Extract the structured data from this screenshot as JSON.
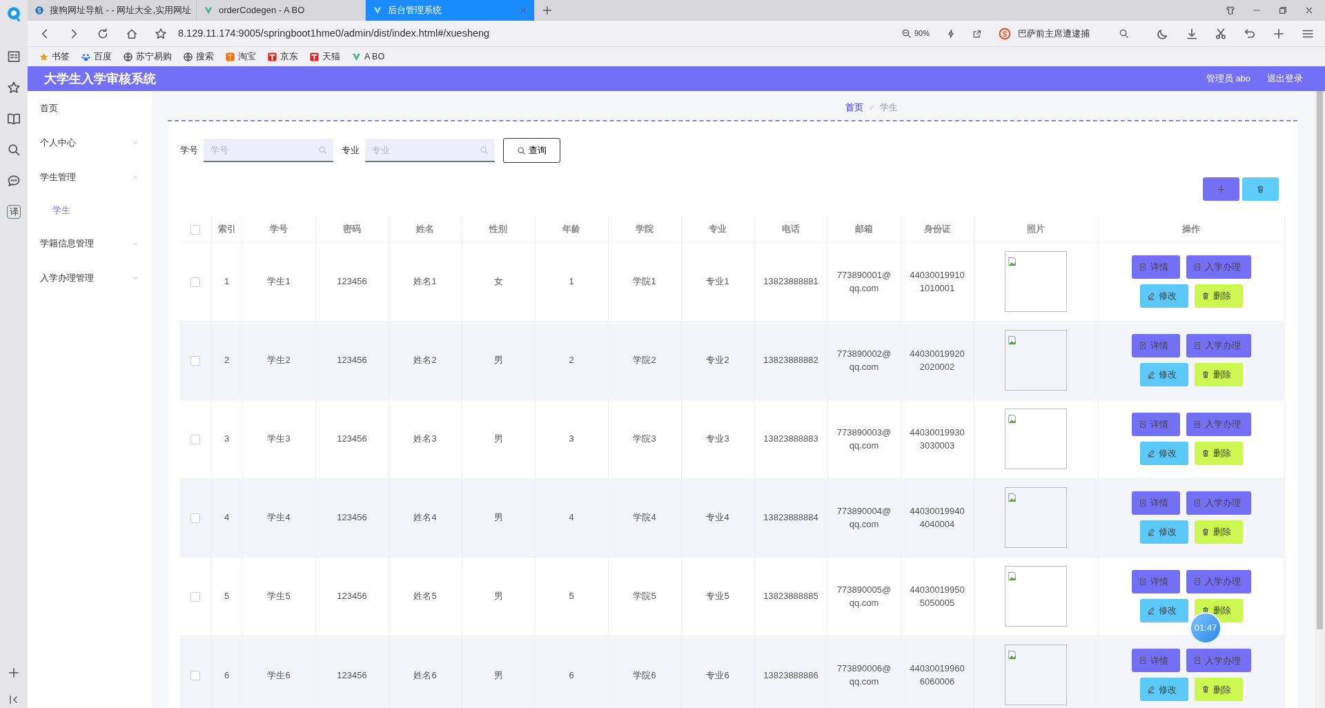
{
  "browser": {
    "tabs": [
      {
        "title": "搜狗网址导航 - - 网址大全,实用网址",
        "selected": false
      },
      {
        "title": "orderCodegen - A BO",
        "selected": false
      },
      {
        "title": "后台管理系统",
        "selected": true
      }
    ],
    "address": "8.129.11.174:9005/springboot1hme0/admin/dist/index.html#/xuesheng",
    "zoom": "90%",
    "search_text": "巴萨前主席遭逮捕",
    "bookmarks": [
      "书签",
      "百度",
      "苏宁易购",
      "搜索",
      "淘宝",
      "京东",
      "天猫",
      "A BO"
    ],
    "side_translate": "译"
  },
  "app": {
    "title": "大学生入学审核系统",
    "user": "管理员 abo",
    "logout": "退出登录"
  },
  "sidebar": {
    "items": [
      {
        "label": "首页"
      },
      {
        "label": "个人中心",
        "expanded": false
      },
      {
        "label": "学生管理",
        "expanded": true,
        "children": [
          {
            "label": "学生",
            "selected": true
          }
        ]
      },
      {
        "label": "学籍信息管理",
        "expanded": false
      },
      {
        "label": "入学办理管理",
        "expanded": false
      }
    ]
  },
  "breadcrumb": [
    "首页",
    "学生"
  ],
  "filters": [
    {
      "label": "学号",
      "placeholder": "学号"
    },
    {
      "label": "专业",
      "placeholder": "专业"
    }
  ],
  "query_button": "查询",
  "table": {
    "header_checked": false,
    "columns": [
      "索引",
      "学号",
      "密码",
      "姓名",
      "性别",
      "年龄",
      "学院",
      "专业",
      "电话",
      "邮箱",
      "身份证",
      "照片",
      "操作"
    ],
    "rows": [
      {
        "checked": false,
        "cells": [
          "1",
          "学生1",
          "123456",
          "姓名1",
          "女",
          "1",
          "学院1",
          "专业1",
          "13823888881",
          "773890001@qq.com",
          "440300199101010001"
        ],
        "actions": [
          "详情",
          "入学办理",
          "修改",
          "删除"
        ]
      },
      {
        "checked": false,
        "cells": [
          "2",
          "学生2",
          "123456",
          "姓名2",
          "男",
          "2",
          "学院2",
          "专业2",
          "13823888882",
          "773890002@qq.com",
          "440300199202020002"
        ],
        "actions": [
          "详情",
          "入学办理",
          "修改",
          "删除"
        ]
      },
      {
        "checked": false,
        "cells": [
          "3",
          "学生3",
          "123456",
          "姓名3",
          "男",
          "3",
          "学院3",
          "专业3",
          "13823888883",
          "773890003@qq.com",
          "440300199303030003"
        ],
        "actions": [
          "详情",
          "入学办理",
          "修改",
          "删除"
        ]
      },
      {
        "checked": false,
        "cells": [
          "4",
          "学生4",
          "123456",
          "姓名4",
          "男",
          "4",
          "学院4",
          "专业4",
          "13823888884",
          "773890004@qq.com",
          "440300199404040004"
        ],
        "actions": [
          "详情",
          "入学办理",
          "修改",
          "删除"
        ]
      },
      {
        "checked": false,
        "cells": [
          "5",
          "学生5",
          "123456",
          "姓名5",
          "男",
          "5",
          "学院5",
          "专业5",
          "13823888885",
          "773890005@qq.com",
          "440300199505050005"
        ],
        "actions": [
          "详情",
          "入学办理",
          "修改",
          "删除"
        ]
      },
      {
        "checked": false,
        "cells": [
          "6",
          "学生6",
          "123456",
          "姓名6",
          "男",
          "6",
          "学院6",
          "专业6",
          "13823888886",
          "773890006@qq.com",
          "440300199606060006"
        ],
        "actions": [
          "详情",
          "入学办理",
          "修改",
          "删除"
        ]
      }
    ]
  },
  "timer": "01:47"
}
